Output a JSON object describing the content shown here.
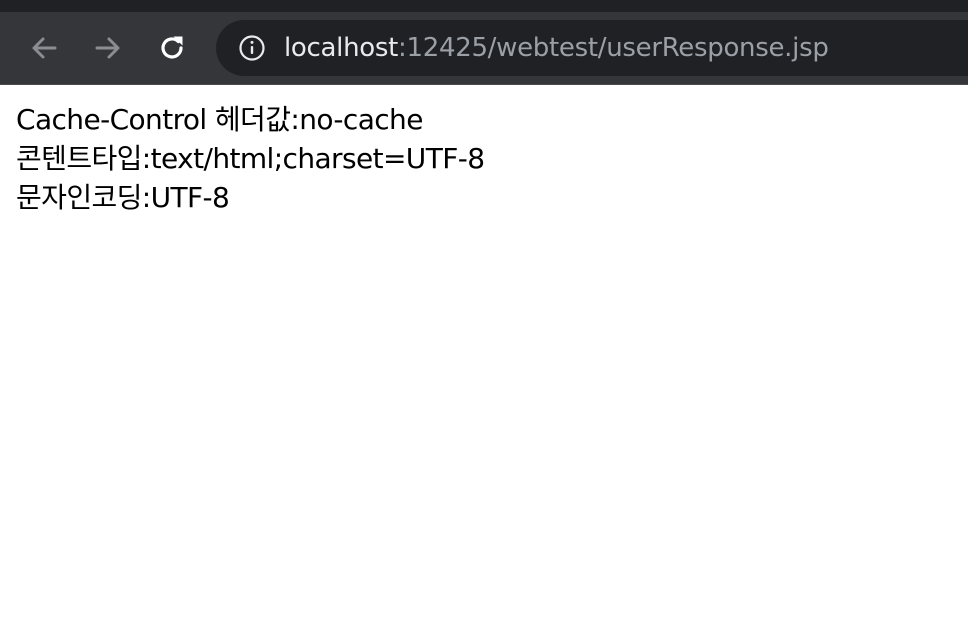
{
  "browser": {
    "url_host": "localhost",
    "url_rest": ":12425/webtest/userResponse.jsp",
    "icons": {
      "back": "arrow-left-icon",
      "forward": "arrow-right-icon",
      "reload": "reload-icon",
      "site_info": "info-icon"
    },
    "colors": {
      "toolbar": "#35363a",
      "omnibox": "#202124",
      "host_text": "#e8eaed",
      "path_text": "#9aa0a6"
    }
  },
  "page": {
    "lines": [
      "Cache-Control 헤더값:no-cache",
      "콘텐트타입:text/html;charset=UTF-8",
      "문자인코딩:UTF-8"
    ]
  }
}
